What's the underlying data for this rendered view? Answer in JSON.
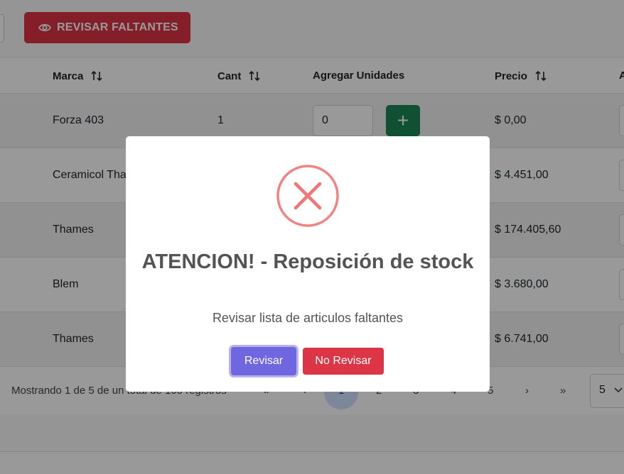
{
  "toolbar": {
    "review_button_label": "REVISAR FALTANTES"
  },
  "table": {
    "headers": {
      "marca": "Marca",
      "cant": "Cant",
      "agregar": "Agregar Unidades",
      "precio": "Precio",
      "extra": "A"
    },
    "rows": [
      {
        "marca": "Forza 403",
        "cant": "1",
        "agregar": "0",
        "add_symbol": "+",
        "precio": "$ 0,00"
      },
      {
        "marca": "Ceramicol Tha",
        "precio": "$ 4.451,00"
      },
      {
        "marca": "Thames",
        "precio": "$ 174.405,60"
      },
      {
        "marca": "Blem",
        "precio": "$ 3.680,00"
      },
      {
        "marca": "Thames",
        "precio": "$ 6.741,00"
      }
    ]
  },
  "pagination": {
    "summary": "Mostrando 1 de 5 de un total de 100 registros",
    "first": "«",
    "prev": "‹",
    "pages": [
      "1",
      "2",
      "3",
      "4",
      "5"
    ],
    "next": "›",
    "last": "»",
    "page_size": "5"
  },
  "modal": {
    "icon": "error-x-icon",
    "title": "ATENCION! - Reposición de stock",
    "text": "Revisar lista de articulos faltantes",
    "confirm_label": "Revisar",
    "cancel_label": "No Revisar",
    "colors": {
      "icon": "#f27474",
      "confirm": "#7066e0",
      "cancel": "#dc3545"
    }
  }
}
